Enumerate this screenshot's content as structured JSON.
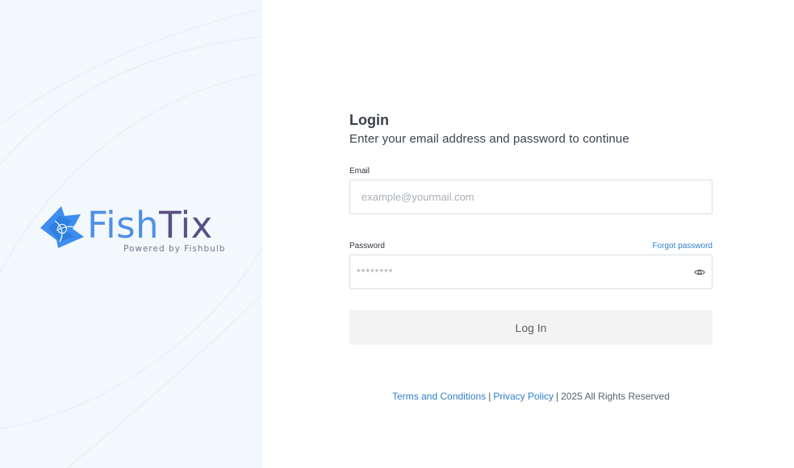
{
  "brand": {
    "name_part1": "Fish",
    "name_part2": "Tix",
    "powered_by": "Powered by Fishbulb",
    "primary_color": "#4f8fe6",
    "secondary_color": "#5a4f86"
  },
  "login": {
    "title": "Login",
    "subtitle": "Enter your email address and password to continue",
    "email_label": "Email",
    "email_placeholder": "example@yourmail.com",
    "email_value": "",
    "password_label": "Password",
    "password_placeholder": "********",
    "password_value": "",
    "forgot_password": "Forgot password",
    "submit_label": "Log In"
  },
  "footer": {
    "terms": "Terms and Conditions",
    "separator": "|",
    "privacy": "Privacy Policy",
    "rights": "2025 All Rights Reserved"
  },
  "icons": {
    "password_toggle": "eye-icon",
    "logo": "fishtix-logo-icon"
  }
}
